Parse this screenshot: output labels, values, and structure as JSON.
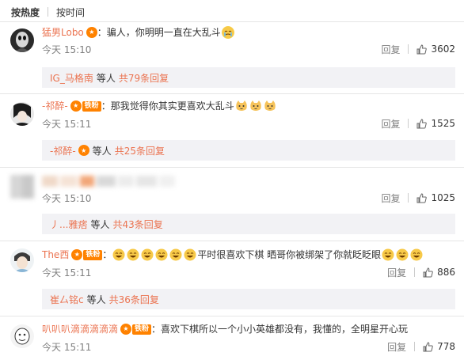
{
  "sort": {
    "hot": "按热度",
    "time": "按时间"
  },
  "comments": [
    {
      "username": "猛男Lobo",
      "text": "：骗人，你明明一直在大乱斗",
      "time": "今天 15:10",
      "reply": "回复",
      "likes": "3602",
      "fan_badge": "",
      "sub": {
        "name": "IG_马格南",
        "deng": "等人",
        "count": "共79条回复"
      }
    },
    {
      "username": "-祁醉-",
      "text": "：那我觉得你其实更喜欢大乱斗",
      "time": "今天 15:11",
      "reply": "回复",
      "likes": "1525",
      "fan_badge": "铁粉",
      "sub": {
        "name": "-祁醉-",
        "deng": "等人",
        "count": "共25条回复"
      }
    },
    {
      "username": "",
      "text": "",
      "time": "今天 15:10",
      "reply": "回复",
      "likes": "1025",
      "fan_badge": "",
      "sub": {
        "name": "丿...雅痞",
        "deng": "等人",
        "count": "共43条回复"
      }
    },
    {
      "username": "The西",
      "text": "平时很喜欢下棋 晒哥你被绑架了你就眨眨眼",
      "time": "今天 15:11",
      "reply": "回复",
      "likes": "886",
      "fan_badge": "铁粉",
      "sub": {
        "name": "崔厶铭c",
        "deng": "等人",
        "count": "共36条回复"
      }
    },
    {
      "username": "叭叭叭滴滴滴滴滴",
      "text": "：喜欢下棋所以一个小小英雄都没有，我懂的，全明星开心玩",
      "time": "今天 15:11",
      "reply": "回复",
      "likes": "778",
      "fan_badge": "铁粉"
    }
  ],
  "colors": {
    "username": "#eb7350",
    "badge": "#ff8200",
    "subbox": "#f2f2f5"
  }
}
